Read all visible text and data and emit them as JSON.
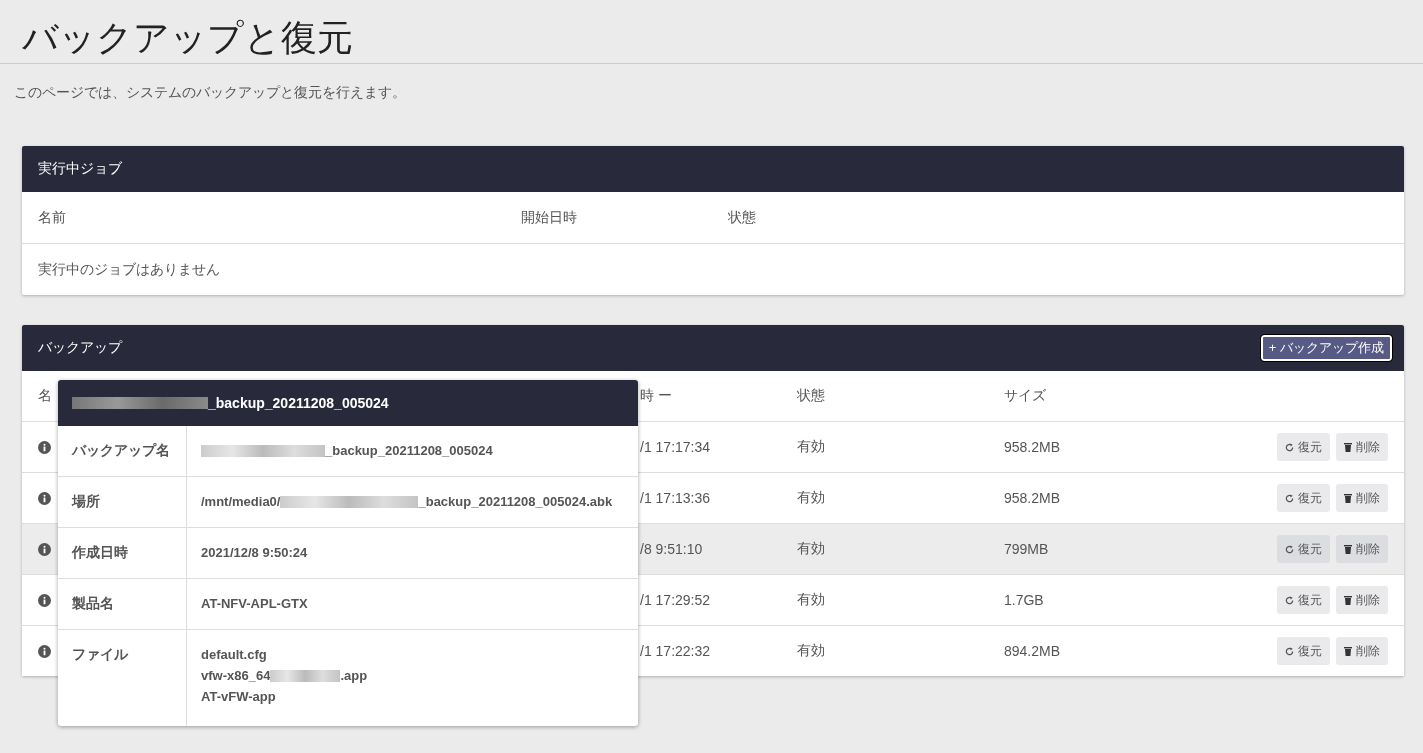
{
  "page_title": "バックアップと復元",
  "description": "このページでは、システムのバックアップと復元を行えます。",
  "running_jobs": {
    "title": "実行中ジョブ",
    "columns": [
      "名前",
      "開始日時",
      "状態"
    ],
    "empty_message": "実行中のジョブはありません"
  },
  "backups": {
    "title": "バックアップ",
    "create_button": "+ バックアップ作成",
    "columns": [
      {
        "label": "名"
      },
      {
        "label": "時 ー"
      },
      {
        "label": "状態"
      },
      {
        "label": "サイズ"
      }
    ],
    "rows": [
      {
        "created": "/1 17:17:34",
        "status": "有効",
        "size": "958.2MB",
        "highlighted": false,
        "restore_label": "復元",
        "delete_label": "削除"
      },
      {
        "created": "/1 17:13:36",
        "status": "有効",
        "size": "958.2MB",
        "highlighted": false,
        "restore_label": "復元",
        "delete_label": "削除"
      },
      {
        "created": "/8 9:51:10",
        "status": "有効",
        "size": "799MB",
        "highlighted": true,
        "restore_label": "復元",
        "delete_label": "削除"
      },
      {
        "created": "/1 17:29:52",
        "status": "有効",
        "size": "1.7GB",
        "highlighted": false,
        "restore_label": "復元",
        "delete_label": "削除"
      },
      {
        "created": "/1 17:22:32",
        "status": "有効",
        "size": "894.2MB",
        "highlighted": false,
        "restore_label": "復元",
        "delete_label": "削除"
      }
    ]
  },
  "popover": {
    "title": "_backup_20211208_005024",
    "fields": [
      {
        "label": "バックアップ名",
        "lines": [
          {
            "redacted": true,
            "text": "_backup_20211208_005024"
          }
        ]
      },
      {
        "label": "場所",
        "lines": [
          {
            "prefix": "/mnt/media0/",
            "redacted": true,
            "text": "_backup_20211208_005024.abk"
          }
        ]
      },
      {
        "label": "作成日時",
        "lines": [
          {
            "redacted": false,
            "text": "2021/12/8 9:50:24"
          }
        ]
      },
      {
        "label": "製品名",
        "lines": [
          {
            "redacted": false,
            "text": "AT-NFV-APL-GTX"
          }
        ]
      },
      {
        "label": "ファイル",
        "lines": [
          {
            "redacted": false,
            "text": "default.cfg"
          },
          {
            "prefix": "vfw-x86_64",
            "redacted": true,
            "text": ".app"
          },
          {
            "redacted": false,
            "text": "AT-vFW-app"
          }
        ]
      }
    ]
  }
}
